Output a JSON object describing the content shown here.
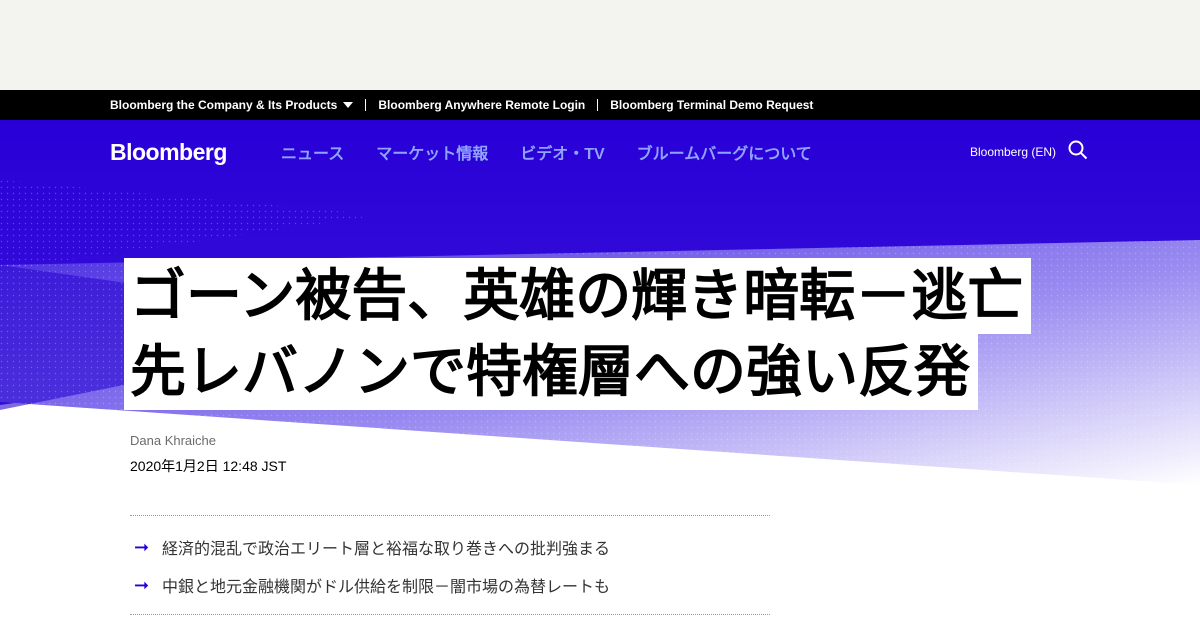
{
  "topbar": {
    "items": [
      "Bloomberg the Company & Its Products",
      "Bloomberg Anywhere Remote Login",
      "Bloomberg Terminal Demo Request"
    ]
  },
  "nav": {
    "logo": "Bloomberg",
    "items": [
      "ニュース",
      "マーケット情報",
      "ビデオ・TV",
      "ブルームバーグについて"
    ],
    "edition": "Bloomberg (EN)",
    "search_icon": "search-icon"
  },
  "article": {
    "headline_lines": [
      "ゴーン被告、英雄の輝き暗転－逃亡",
      "先レバノンで特権層への強い反発"
    ],
    "author": "Dana Khraiche",
    "datetime": "2020年1月2日 12:48 JST",
    "summary": [
      "経済的混乱で政治エリート層と裕福な取り巻きへの批判強まる",
      "中銀と地元金融機関がドル供給を制限－闇市場の為替レートも"
    ]
  },
  "colors": {
    "brand_blue": "#2800d7",
    "nav_link": "#8fa3ff",
    "topbar_bg": "#000000",
    "ad_bg": "#f3f3f0"
  }
}
